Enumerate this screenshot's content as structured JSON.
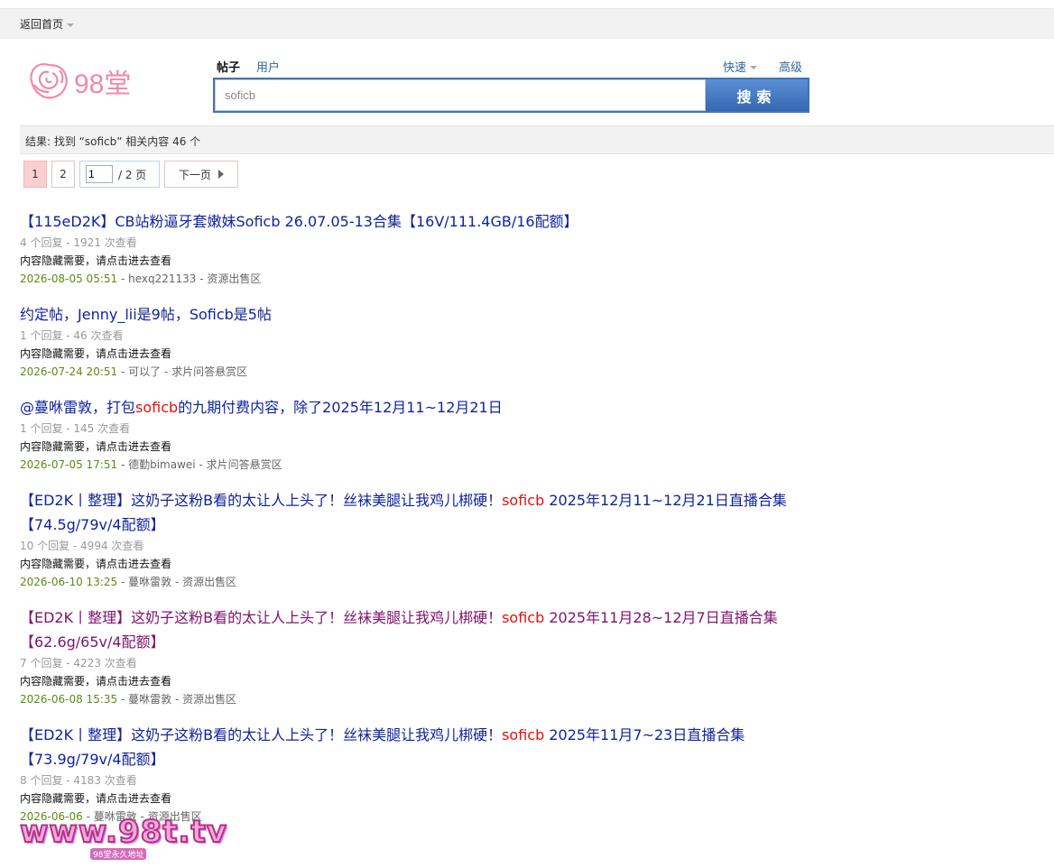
{
  "topbar": {
    "home_label": "返回首页"
  },
  "logo": {
    "text": "98堂"
  },
  "search": {
    "tabs": [
      "帖子",
      "用户"
    ],
    "quick_label": "快速",
    "advanced_label": "高级",
    "query": "soficb",
    "button_label": "搜索"
  },
  "result_summary": "结果: 找到 “soficb” 相关内容 46 个",
  "pager": {
    "current": "1",
    "page2": "2",
    "jump_value": "1",
    "total": "/ 2 页",
    "next_label": "下一页"
  },
  "results": [
    {
      "title_parts": [
        "【115eD2K】CB站粉逼牙套嫩妹Soficb 26.07.05-13合集【16V/111.4GB/16配额】"
      ],
      "visited": false,
      "stats": "4 个回复 - 1921 次查看",
      "note": "内容隐藏需要，请点击进去查看",
      "date": "2026-08-05 05:51",
      "author": "hexq221133",
      "forum": "资源出售区"
    },
    {
      "title_parts": [
        "约定帖，Jenny_lii是9帖，Soficb是5帖"
      ],
      "visited": false,
      "stats": "1 个回复 - 46 次查看",
      "note": "内容隐藏需要，请点击进去查看",
      "date": "2026-07-24 20:51",
      "author": "可以了",
      "forum": "求片问答悬赏区"
    },
    {
      "title_parts": [
        "@蔓咻雷敦，打包",
        "soficb",
        "的九期付费内容，除了2025年12月11~12月21日"
      ],
      "visited": false,
      "stats": "1 个回复 - 145 次查看",
      "note": "内容隐藏需要，请点击进去查看",
      "date": "2026-07-05 17:51",
      "author": "德勤bimawei",
      "forum": "求片问答悬赏区"
    },
    {
      "title_parts": [
        "【ED2K丨整理】这奶子这粉B看的太让人上头了！丝袜美腿让我鸡儿梆硬！",
        "soficb",
        " 2025年12月11~12月21日直播合集【74.5g/79v/4配额】"
      ],
      "visited": false,
      "stats": "10 个回复 - 4994 次查看",
      "note": "内容隐藏需要，请点击进去查看",
      "date": "2026-06-10 13:25",
      "author": "蔓咻雷敦",
      "forum": "资源出售区"
    },
    {
      "title_parts": [
        "【ED2K丨整理】这奶子这粉B看的太让人上头了！丝袜美腿让我鸡儿梆硬！",
        "soficb",
        " 2025年11月28~12月7日直播合集【62.6g/65v/4配额】"
      ],
      "visited": true,
      "stats": "7 个回复 - 4223 次查看",
      "note": "内容隐藏需要，请点击进去查看",
      "date": "2026-06-08 15:35",
      "author": "蔓咻雷敦",
      "forum": "资源出售区"
    },
    {
      "title_parts": [
        "【ED2K丨整理】这奶子这粉B看的太让人上头了！丝袜美腿让我鸡儿梆硬！",
        "soficb",
        " 2025年11月7~23日直播合集【73.9g/79v/4配额】"
      ],
      "visited": false,
      "stats": "8 个回复 - 4183 次查看",
      "note": "内容隐藏需要，请点击进去查看",
      "date": "2026-06-06",
      "author": "蔓咻雷敦",
      "forum": "资源出售区"
    }
  ],
  "watermark": {
    "text": "www.98t.tv",
    "sub": "98堂永久地址"
  },
  "colors": {
    "link": "#10239e",
    "visited": "#80146e",
    "highlight": "#e41010",
    "date": "#5f8a16",
    "search_blue": "#3f74b8"
  }
}
